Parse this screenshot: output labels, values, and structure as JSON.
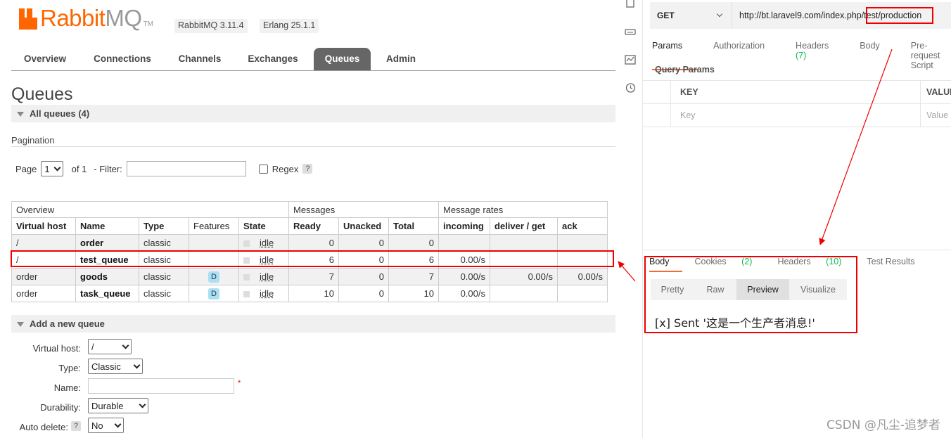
{
  "rabbitmq": {
    "logo": {
      "brand": "Rabbit",
      "suffix": "MQ",
      "tm": "TM"
    },
    "version_badge": "RabbitMQ 3.11.4",
    "erlang_badge": "Erlang 25.1.1",
    "nav_tabs": [
      "Overview",
      "Connections",
      "Channels",
      "Exchanges",
      "Queues",
      "Admin"
    ],
    "active_tab": "Queues",
    "page_title": "Queues",
    "all_queues_label": "All queues (4)",
    "pagination": {
      "label": "Pagination",
      "page_label": "Page",
      "page_value": "1",
      "of_label": "of 1",
      "filter_label": "- Filter:",
      "filter_value": "",
      "regex_label": "Regex",
      "help": "?"
    },
    "table": {
      "groups": [
        "Overview",
        "Messages",
        "Message rates"
      ],
      "columns": [
        "Virtual host",
        "Name",
        "Type",
        "Features",
        "State",
        "Ready",
        "Unacked",
        "Total",
        "incoming",
        "deliver / get",
        "ack"
      ],
      "rows": [
        {
          "vhost": "/",
          "name": "order",
          "type": "classic",
          "feature": "",
          "state": "idle",
          "ready": "0",
          "unacked": "0",
          "total": "0",
          "incoming": "",
          "deliver": "",
          "ack": ""
        },
        {
          "vhost": "/",
          "name": "test_queue",
          "type": "classic",
          "feature": "",
          "state": "idle",
          "ready": "6",
          "unacked": "0",
          "total": "6",
          "incoming": "0.00/s",
          "deliver": "",
          "ack": ""
        },
        {
          "vhost": "order",
          "name": "goods",
          "type": "classic",
          "feature": "D",
          "state": "idle",
          "ready": "7",
          "unacked": "0",
          "total": "7",
          "incoming": "0.00/s",
          "deliver": "0.00/s",
          "ack": "0.00/s"
        },
        {
          "vhost": "order",
          "name": "task_queue",
          "type": "classic",
          "feature": "D",
          "state": "idle",
          "ready": "10",
          "unacked": "0",
          "total": "10",
          "incoming": "0.00/s",
          "deliver": "",
          "ack": ""
        }
      ]
    },
    "add_queue": {
      "title": "Add a new queue",
      "virtual_host_label": "Virtual host:",
      "virtual_host_value": "/",
      "type_label": "Type:",
      "type_value": "Classic",
      "name_label": "Name:",
      "name_value": "",
      "required_mark": "*",
      "durability_label": "Durability:",
      "durability_value": "Durable",
      "auto_delete_label": "Auto delete:",
      "auto_delete_value": "No",
      "help": "?"
    }
  },
  "postman": {
    "method": "GET",
    "url": "http://bt.laravel9.com/index.php/test/production",
    "request_tabs": [
      {
        "label": "Params",
        "count": ""
      },
      {
        "label": "Authorization",
        "count": ""
      },
      {
        "label": "Headers",
        "count": "(7)"
      },
      {
        "label": "Body",
        "count": ""
      },
      {
        "label": "Pre-request Script",
        "count": ""
      }
    ],
    "query_params_title": "Query Params",
    "kv_header": {
      "key": "KEY",
      "value": "VALUE"
    },
    "kv_placeholder": {
      "key": "Key",
      "value": "Value"
    },
    "response_tabs": [
      {
        "label": "Body",
        "count": ""
      },
      {
        "label": "Cookies",
        "count": "(2)"
      },
      {
        "label": "Headers",
        "count": "(10)"
      },
      {
        "label": "Test Results",
        "count": ""
      }
    ],
    "view_modes": [
      "Pretty",
      "Raw",
      "Preview",
      "Visualize"
    ],
    "active_view": "Preview",
    "response_output": "[x] Sent '这是一个生产者消息!'"
  },
  "watermark": "CSDN @凡尘-追梦者",
  "colors": {
    "rabbit_orange": "#ff6600",
    "postman_orange": "#f26b3a",
    "highlight_red": "#e00000",
    "count_green": "#0cbb52"
  }
}
